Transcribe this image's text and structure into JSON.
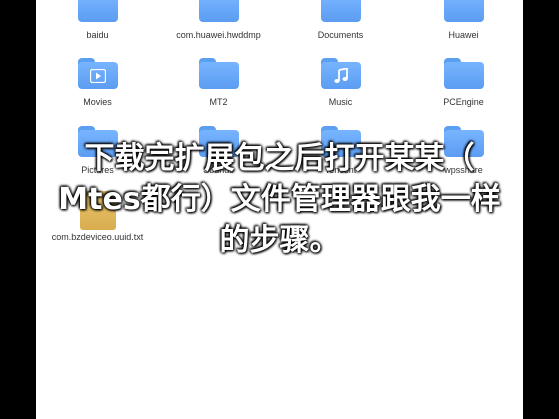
{
  "folders_row1": [
    "baidu",
    "com.huawei.hwddmp",
    "Documents",
    "Huawei"
  ],
  "folders_row2": [
    "Movies",
    "MT2",
    "Music",
    "PCEngine"
  ],
  "folders_row3": [
    "Pictures",
    "Sounds",
    "Tencent",
    "wpsshare"
  ],
  "file": {
    "name": "com.bzdeviceo.uuid.txt"
  },
  "icons": {
    "movies": "play-icon",
    "music": "music-note-icon",
    "file": "text-file-icon"
  },
  "overlay_caption": [
    "下载完扩展包之后打开某某（",
    "Mtes都行）文件管理器跟我一样",
    "的步骤。"
  ],
  "colors": {
    "folder": "#6aa9fa",
    "file": "#dcb255",
    "caption": "#ffffff"
  }
}
